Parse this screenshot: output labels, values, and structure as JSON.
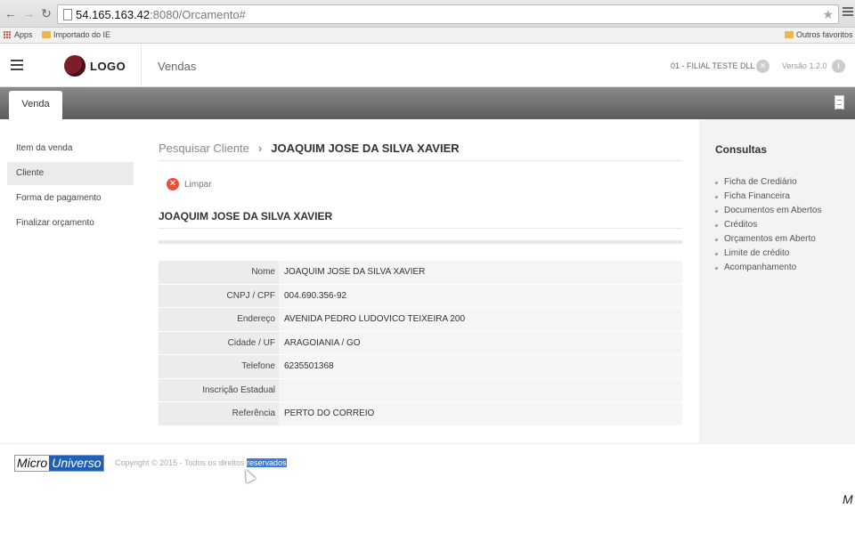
{
  "browser": {
    "url_host": "54.165.163.42",
    "url_path": ":8080/Orcamento#",
    "bookmarks": {
      "apps": "Apps",
      "imported": "Importado do IE",
      "others": "Outros favoritos"
    }
  },
  "header": {
    "logo_text": "LOGO",
    "title": "Vendas",
    "filial": "01 - FILIAL TESTE DLL",
    "version": "Versão 1.2.0"
  },
  "tabs": [
    {
      "label": "Venda"
    }
  ],
  "sidebar": {
    "items": [
      {
        "label": "Item da venda"
      },
      {
        "label": "Cliente"
      },
      {
        "label": "Forma de pagamento"
      },
      {
        "label": "Finalizar orçamento"
      }
    ]
  },
  "main": {
    "breadcrumb_parent": "Pesquisar Cliente",
    "breadcrumb_sep": "›",
    "breadcrumb_current": "JOAQUIM JOSE DA SILVA XAVIER",
    "clear_label": "Limpar",
    "client_name": "JOAQUIM JOSE DA SILVA XAVIER",
    "details": [
      {
        "label": "Nome",
        "value": "JOAQUIM JOSE DA SILVA XAVIER"
      },
      {
        "label": "CNPJ / CPF",
        "value": "004.690.356-92"
      },
      {
        "label": "Endereço",
        "value": "AVENIDA PEDRO LUDOVICO TEIXEIRA 200"
      },
      {
        "label": "Cidade / UF",
        "value": "ARAGOIANIA / GO"
      },
      {
        "label": "Telefone",
        "value": "6235501368"
      },
      {
        "label": "Inscrição Estadual",
        "value": ""
      },
      {
        "label": "Referência",
        "value": "PERTO DO CORREIO"
      }
    ]
  },
  "consultas": {
    "title": "Consultas",
    "items": [
      "Ficha de Crediário",
      "Ficha Financeira",
      "Documentos em Abertos",
      "Créditos",
      "Orçamentos em Aberto",
      "Limite de crédito",
      "Acompanhamento"
    ]
  },
  "footer": {
    "logo_part1": "Micro",
    "logo_part2": "Universo",
    "copyright": "Copyright © 2015 - Todos os direitos ",
    "copyright_selected": "reservados",
    "corner_letter": "M"
  },
  "colors": {
    "brand_dark_red": "#7a1f28",
    "clear_red": "#e8503a",
    "footer_blue": "#1c5fbd",
    "selection_blue": "#3a7bdb"
  },
  "icons": [
    "back-arrow-icon",
    "forward-arrow-icon",
    "reload-icon",
    "page-icon",
    "star-icon",
    "chrome-menu-icon",
    "folder-icon",
    "hamburger-icon",
    "close-circle-icon",
    "info-icon",
    "document-icon",
    "cursor-icon"
  ]
}
